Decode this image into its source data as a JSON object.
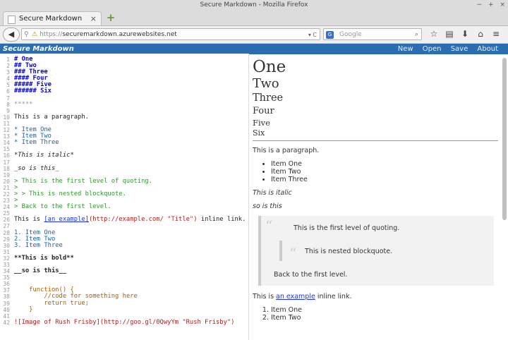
{
  "window": {
    "title": "Secure Markdown - Mozilla Firefox"
  },
  "tab": {
    "label": "Secure Markdown"
  },
  "navbar": {
    "url_scheme": "https://",
    "url_host": "securemarkdown.azurewebsites.net",
    "search_placeholder": "Google"
  },
  "app": {
    "brand": "Secure Markdown",
    "menu": [
      "New",
      "Open",
      "Save",
      "About"
    ]
  },
  "editor": {
    "lines": [
      {
        "n": "1",
        "t": "# One",
        "c": "h"
      },
      {
        "n": "2",
        "t": "## Two",
        "c": "h"
      },
      {
        "n": "3",
        "t": "### Three",
        "c": "h"
      },
      {
        "n": "4",
        "t": "#### Four",
        "c": "h"
      },
      {
        "n": "5",
        "t": "##### Five",
        "c": "h"
      },
      {
        "n": "6",
        "t": "###### Six",
        "c": "h"
      },
      {
        "n": "7",
        "t": "",
        "c": ""
      },
      {
        "n": "8",
        "t": "*****",
        "c": "hr"
      },
      {
        "n": "9",
        "t": "",
        "c": ""
      },
      {
        "n": "10",
        "t": "This is a paragraph.",
        "c": ""
      },
      {
        "n": "11",
        "t": "",
        "c": ""
      },
      {
        "n": "12",
        "t": "* Item One",
        "c": "blue"
      },
      {
        "n": "13",
        "t": "* Item Two",
        "c": "blue"
      },
      {
        "n": "14",
        "t": "* Item Three",
        "c": "blue"
      },
      {
        "n": "15",
        "t": "",
        "c": ""
      },
      {
        "n": "16",
        "t": "*This is italic*",
        "c": "ital"
      },
      {
        "n": "17",
        "t": "",
        "c": ""
      },
      {
        "n": "18",
        "t": "_so is this_",
        "c": "ital"
      },
      {
        "n": "19",
        "t": "",
        "c": ""
      },
      {
        "n": "20",
        "t": "> This is the first level of quoting.",
        "c": "green"
      },
      {
        "n": "21",
        "t": ">",
        "c": "green"
      },
      {
        "n": "22",
        "t": "> > This is nested blockquote.",
        "c": "green"
      },
      {
        "n": "23",
        "t": ">",
        "c": "green"
      },
      {
        "n": "24",
        "t": "> Back to the first level.",
        "c": "green"
      },
      {
        "n": "25",
        "t": "",
        "c": ""
      },
      {
        "n": "26",
        "t": "__LINK__",
        "c": "link-line"
      },
      {
        "n": "27",
        "t": "",
        "c": ""
      },
      {
        "n": "28",
        "t": "1. Item One",
        "c": "blue"
      },
      {
        "n": "29",
        "t": "2. Item Two",
        "c": "blue"
      },
      {
        "n": "30",
        "t": "3. Item Three",
        "c": "blue"
      },
      {
        "n": "31",
        "t": "",
        "c": ""
      },
      {
        "n": "32",
        "t": "**This is bold**",
        "c": "bold"
      },
      {
        "n": "33",
        "t": "",
        "c": ""
      },
      {
        "n": "34",
        "t": "__so is this__",
        "c": "bold"
      },
      {
        "n": "35",
        "t": "",
        "c": ""
      },
      {
        "n": "36",
        "t": "",
        "c": ""
      },
      {
        "n": "37",
        "t": "    function() {",
        "c": "orange"
      },
      {
        "n": "38",
        "t": "        //code for something here",
        "c": "orange"
      },
      {
        "n": "39",
        "t": "        return true;",
        "c": "orange"
      },
      {
        "n": "40",
        "t": "    }",
        "c": "orange"
      },
      {
        "n": "41",
        "t": "",
        "c": ""
      },
      {
        "n": "42",
        "t": "![Image of Rush Frisby](http://goo.gl/0QwyYm \"Rush Frisby\")",
        "c": "red"
      }
    ],
    "link_line": {
      "prefix": "This is ",
      "text": "[an example]",
      "url": "(http://example.com/ \"Title\")",
      "suffix": " inline link."
    }
  },
  "preview": {
    "h1": "One",
    "h2": "Two",
    "h3": "Three",
    "h4": "Four",
    "h5": "Five",
    "h6": "Six",
    "paragraph": "This is a paragraph.",
    "bullets": [
      "Item One",
      "Item Two",
      "Item Three"
    ],
    "italic1": "This is italic",
    "italic2": "so is this",
    "quote1": "This is the first level of quoting.",
    "quote_nested": "This is nested blockquote.",
    "quote3": "Back to the first level.",
    "link_prefix": "This is ",
    "link_text": "an example",
    "link_suffix": " inline link.",
    "ordered": [
      "Item One",
      "Item Two"
    ]
  }
}
